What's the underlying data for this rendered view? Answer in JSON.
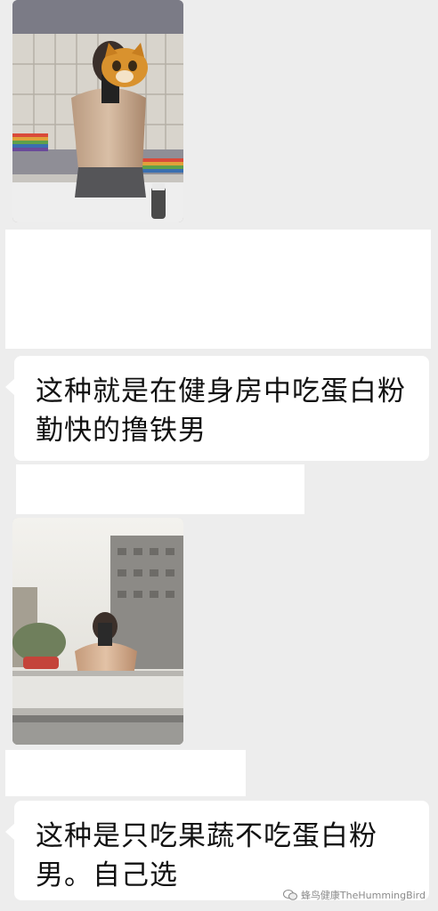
{
  "messages": [
    {
      "type": "image",
      "description_key": "gym-locker-selfie"
    },
    {
      "type": "blank"
    },
    {
      "type": "text",
      "text": "这种就是在健身房中吃蛋白粉勤快的撸铁男"
    },
    {
      "type": "blank"
    },
    {
      "type": "image",
      "description_key": "street-reflection-selfie"
    },
    {
      "type": "blank"
    },
    {
      "type": "text",
      "text": "这种是只吃果蔬不吃蛋白粉男。自己选"
    }
  ],
  "watermark": {
    "text": "蜂鸟健康TheHummingBird"
  },
  "colors": {
    "background": "#ededed",
    "bubble": "#ffffff",
    "text": "#111111"
  }
}
